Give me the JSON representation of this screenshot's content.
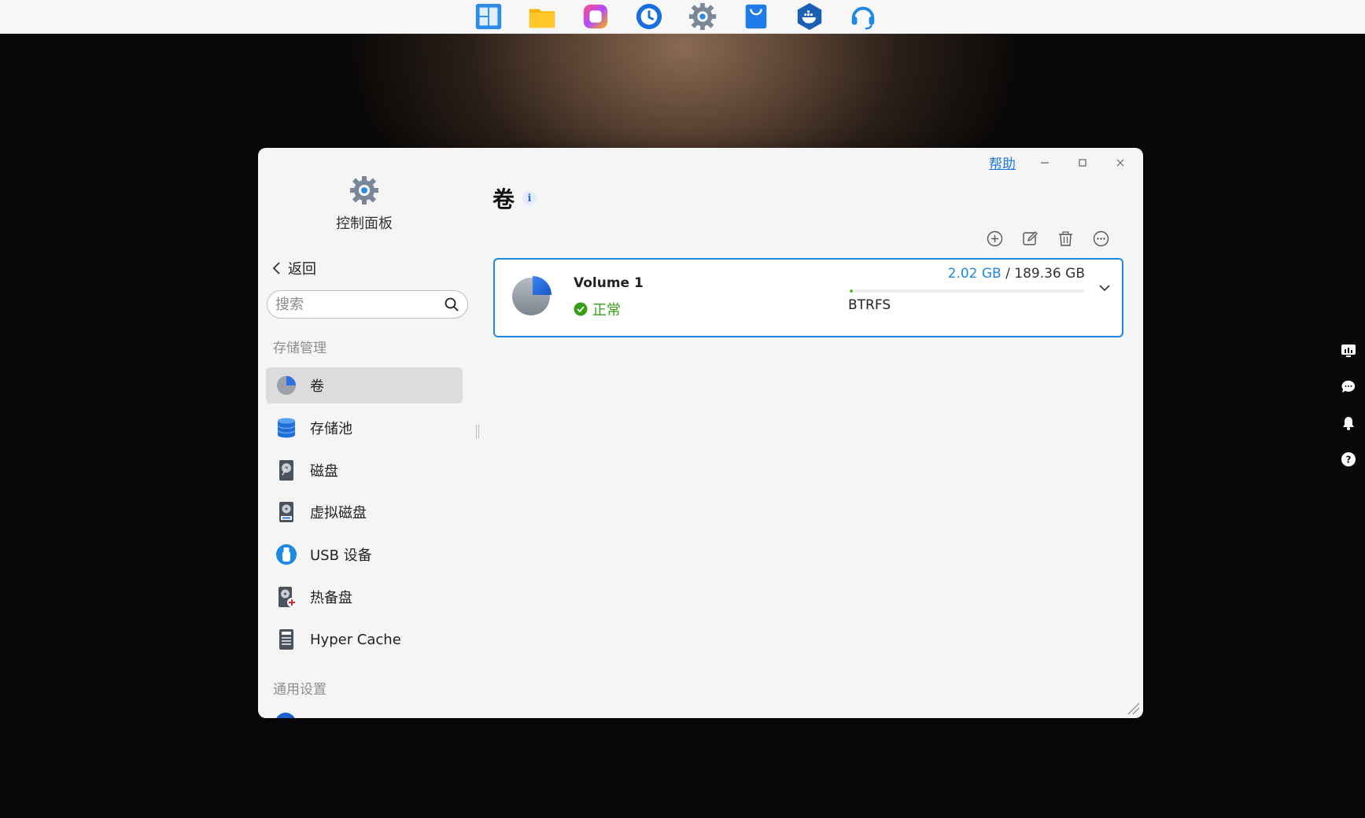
{
  "dock": {
    "icons": [
      "app-center-icon",
      "file-manager-icon",
      "photos-icon",
      "backup-icon",
      "control-panel-icon",
      "app-store-icon",
      "docker-icon",
      "support-icon"
    ]
  },
  "side_tools": [
    "resource-monitor-icon",
    "chat-icon",
    "notification-bell-icon",
    "help-question-icon"
  ],
  "window": {
    "help_label": "帮助",
    "app_title": "控制面板"
  },
  "sidebar": {
    "back_label": "返回",
    "search_placeholder": "搜索",
    "section_storage": "存储管理",
    "section_general": "通用设置",
    "items": [
      {
        "label": "卷",
        "icon": "volume-pie-icon"
      },
      {
        "label": "存储池",
        "icon": "storage-pool-icon"
      },
      {
        "label": "磁盘",
        "icon": "disk-icon"
      },
      {
        "label": "虚拟磁盘",
        "icon": "virtual-disk-icon"
      },
      {
        "label": "USB 设备",
        "icon": "usb-icon"
      },
      {
        "label": "热备盘",
        "icon": "hot-spare-icon"
      },
      {
        "label": "Hyper Cache",
        "icon": "ssd-cache-icon"
      }
    ]
  },
  "main": {
    "title": "卷",
    "toolbar": [
      "add-icon",
      "edit-icon",
      "delete-icon",
      "more-icon"
    ],
    "volume": {
      "name": "Volume 1",
      "status": "正常",
      "used": "2.02 GB",
      "separator": "/",
      "total": "189.36 GB",
      "usage_fraction": 0.011,
      "filesystem": "BTRFS"
    }
  },
  "colors": {
    "accent": "#1e88e5",
    "ok": "#35a016",
    "bar_fill": "#5dbb2a"
  }
}
